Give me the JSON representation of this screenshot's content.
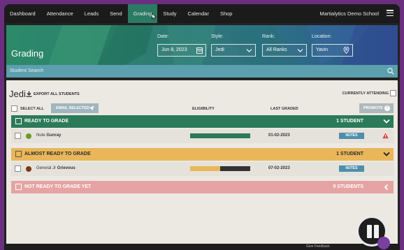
{
  "nav": {
    "items": [
      {
        "label": "Dashboard",
        "active": false
      },
      {
        "label": "Attendance",
        "active": false
      },
      {
        "label": "Leads",
        "active": false
      },
      {
        "label": "Send",
        "active": false
      },
      {
        "label": "Grading",
        "active": true
      },
      {
        "label": "Study",
        "active": false
      },
      {
        "label": "Calendar",
        "active": false
      },
      {
        "label": "Shop",
        "active": false
      }
    ],
    "school_name": "Martialytics Demo School",
    "menu_icon": "hamburger-menu-icon"
  },
  "header": {
    "title": "Grading",
    "date": {
      "label": "Date:",
      "value": "Jun 8, 2023",
      "icon": "calendar-icon"
    },
    "style": {
      "label": "Style:",
      "value": "Jedi",
      "icon": "chevron-down-icon"
    },
    "rank": {
      "label": "Rank:",
      "value": "All Ranks",
      "icon": "chevron-down-icon"
    },
    "location": {
      "label": "Location:",
      "value": "Yavin",
      "icon": "location-pin-icon"
    }
  },
  "search": {
    "placeholder": "Student Search",
    "icon": "search-icon"
  },
  "main": {
    "rank_name": "Jedi",
    "export_label": "EXPORT ALL STUDENTS",
    "currently_attending_label": "CURRENTLY ATTENDING",
    "select_all_label": "SELECT ALL",
    "email_selected_label": "EMAIL SELECTED",
    "promote_label": "PROMOTE",
    "promote_help": "?",
    "columns": {
      "eligibility": "ELIGIBILITY",
      "last_graded": "LAST GRADED"
    }
  },
  "groups": [
    {
      "label": "READY TO GRADE",
      "count": "1 STUDENT",
      "color": "#2b7a5a",
      "expanded": true,
      "students": [
        {
          "name_prefix": "Nute",
          "name_rest": "Gunray",
          "dot_color": "#6b9a2a",
          "eligibility": 1.0,
          "bar_colors": [
            "#2b7a5a",
            "#2b7a5a"
          ],
          "last_graded": "01-02-2023",
          "notes_label": "NOTES",
          "warning": true
        }
      ]
    },
    {
      "label": "ALMOST READY TO GRADE",
      "count": "1 STUDENT",
      "color": "#e9b65a",
      "expanded": true,
      "students": [
        {
          "name_prefix": "General Jr",
          "name_rest": "Grievous",
          "dot_color": "#7a3a12",
          "eligibility": 0.5,
          "bar_colors": [
            "#e9b65a",
            "#333333"
          ],
          "last_graded": "07-02-2023",
          "notes_label": "NOTES",
          "warning": false
        }
      ]
    },
    {
      "label": "NOT READY TO GRADE YET",
      "count": "0 STUDENTS",
      "color": "#e6a3a3",
      "expanded": false,
      "students": []
    }
  ],
  "footer": {
    "feedback_label": "Give Feedback"
  }
}
